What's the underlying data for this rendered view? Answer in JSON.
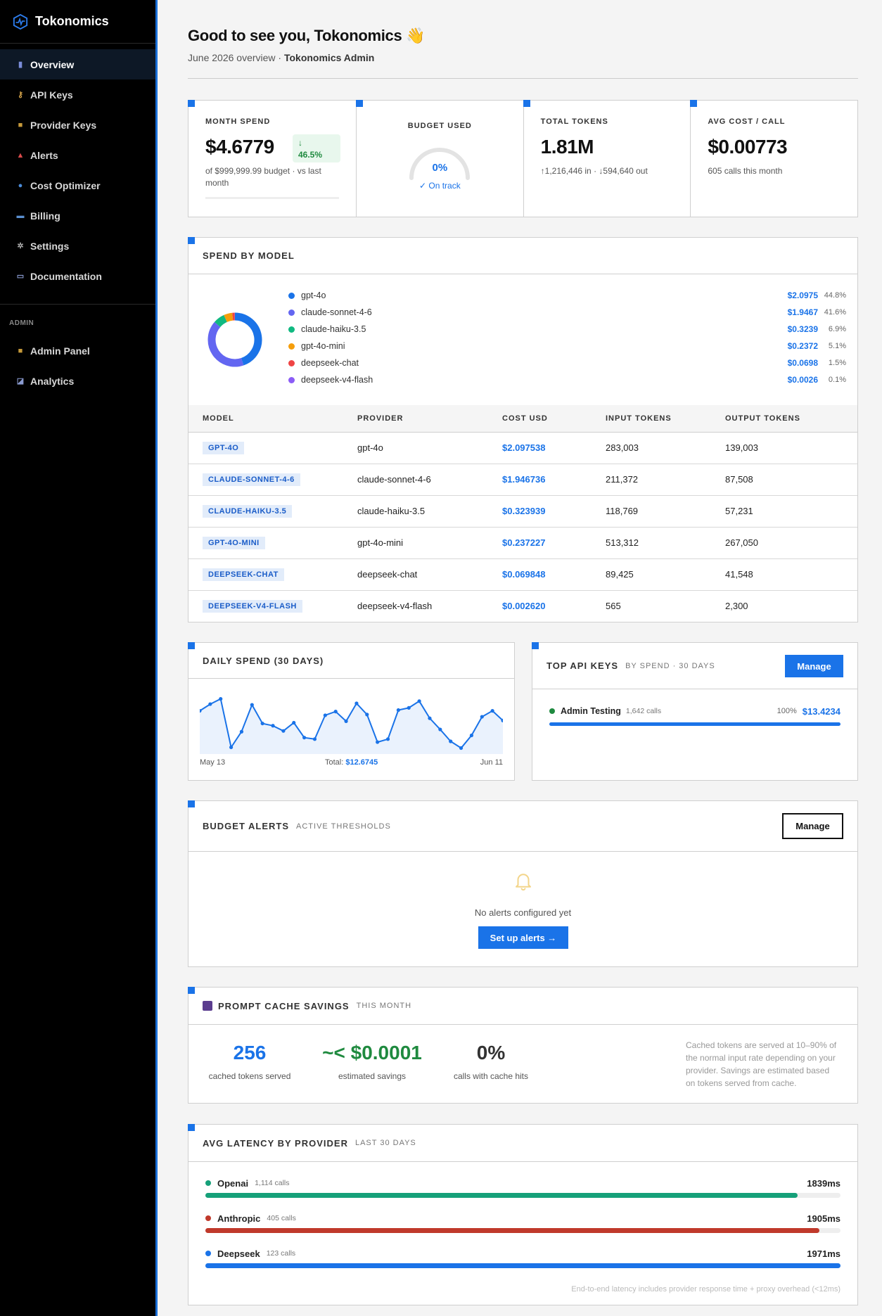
{
  "app": {
    "name": "Tokonomics"
  },
  "sidebar": {
    "items": [
      {
        "label": "Overview",
        "icon": "bar-chart-icon",
        "color": "#7a8cd8"
      },
      {
        "label": "API Keys",
        "icon": "key-icon",
        "color": "#d7a54a"
      },
      {
        "label": "Provider Keys",
        "icon": "lock-icon",
        "color": "#c79a3a"
      },
      {
        "label": "Alerts",
        "icon": "siren-icon",
        "color": "#d94b4b"
      },
      {
        "label": "Cost Optimizer",
        "icon": "magnifier-icon",
        "color": "#4a8bd8"
      },
      {
        "label": "Billing",
        "icon": "credit-card-icon",
        "color": "#5a8fd0"
      },
      {
        "label": "Settings",
        "icon": "gear-icon",
        "color": "#aaaaaa"
      },
      {
        "label": "Documentation",
        "icon": "book-icon",
        "color": "#8a9bd0"
      }
    ],
    "admin_section": "ADMIN",
    "admin_items": [
      {
        "label": "Admin Panel",
        "icon": "lock-icon",
        "color": "#c79a3a"
      },
      {
        "label": "Analytics",
        "icon": "line-chart-icon",
        "color": "#8a9bd0"
      }
    ]
  },
  "header": {
    "greeting": "Good to see you, Tokonomics 👋",
    "sub_prefix": "June 2026 overview · ",
    "sub_bold": "Tokonomics Admin"
  },
  "stats": {
    "month_spend": {
      "label": "MONTH SPEND",
      "value": "$4.6779",
      "change": "46.5%",
      "sub": "of $999,999.99 budget · vs last month"
    },
    "budget_used": {
      "label": "BUDGET USED",
      "value": "0%",
      "status": "✓ On track",
      "fraction": 0
    },
    "total_tokens": {
      "label": "TOTAL TOKENS",
      "value": "1.81M",
      "sub": "↑1,216,446 in · ↓594,640 out"
    },
    "avg_cost": {
      "label": "AVG COST / CALL",
      "value": "$0.00773",
      "sub": "605 calls this month"
    }
  },
  "spend_by_model": {
    "title": "SPEND BY MODEL",
    "legend": [
      {
        "name": "gpt-4o",
        "cost": "$2.0975",
        "pct": "44.8%",
        "share": 44.8,
        "color": "#1a73e8"
      },
      {
        "name": "claude-sonnet-4-6",
        "cost": "$1.9467",
        "pct": "41.6%",
        "share": 41.6,
        "color": "#6366f1"
      },
      {
        "name": "claude-haiku-3.5",
        "cost": "$0.3239",
        "pct": "6.9%",
        "share": 6.9,
        "color": "#10b981"
      },
      {
        "name": "gpt-4o-mini",
        "cost": "$0.2372",
        "pct": "5.1%",
        "share": 5.1,
        "color": "#f59e0b"
      },
      {
        "name": "deepseek-chat",
        "cost": "$0.0698",
        "pct": "1.5%",
        "share": 1.5,
        "color": "#ef4444"
      },
      {
        "name": "deepseek-v4-flash",
        "cost": "$0.0026",
        "pct": "0.1%",
        "share": 0.1,
        "color": "#8b5cf6"
      }
    ],
    "columns": [
      "MODEL",
      "PROVIDER",
      "COST USD",
      "INPUT TOKENS",
      "OUTPUT TOKENS"
    ],
    "rows": [
      {
        "model": "GPT-4O",
        "provider": "gpt-4o",
        "cost": "$2.097538",
        "input": "283,003",
        "output": "139,003"
      },
      {
        "model": "CLAUDE-SONNET-4-6",
        "provider": "claude-sonnet-4-6",
        "cost": "$1.946736",
        "input": "211,372",
        "output": "87,508"
      },
      {
        "model": "CLAUDE-HAIKU-3.5",
        "provider": "claude-haiku-3.5",
        "cost": "$0.323939",
        "input": "118,769",
        "output": "57,231"
      },
      {
        "model": "GPT-4O-MINI",
        "provider": "gpt-4o-mini",
        "cost": "$0.237227",
        "input": "513,312",
        "output": "267,050"
      },
      {
        "model": "DEEPSEEK-CHAT",
        "provider": "deepseek-chat",
        "cost": "$0.069848",
        "input": "89,425",
        "output": "41,548"
      },
      {
        "model": "DEEPSEEK-V4-FLASH",
        "provider": "deepseek-v4-flash",
        "cost": "$0.002620",
        "input": "565",
        "output": "2,300"
      }
    ]
  },
  "daily_spend": {
    "title": "DAILY SPEND (30 DAYS)",
    "start": "May 13",
    "end": "Jun 11",
    "total_label": "Total: ",
    "total_value": "$12.6745"
  },
  "chart_data": {
    "type": "area",
    "x_range": [
      "May 13",
      "Jun 11"
    ],
    "values": [
      0.58,
      0.67,
      0.74,
      0.09,
      0.3,
      0.66,
      0.41,
      0.38,
      0.31,
      0.42,
      0.22,
      0.2,
      0.52,
      0.57,
      0.44,
      0.68,
      0.53,
      0.16,
      0.2,
      0.59,
      0.62,
      0.71,
      0.48,
      0.33,
      0.17,
      0.08,
      0.25,
      0.5,
      0.58,
      0.45
    ],
    "ylim": [
      0,
      0.85
    ],
    "grid": false,
    "color": "#1a73e8"
  },
  "top_keys": {
    "title": "TOP API KEYS",
    "sub": "BY SPEND · 30 DAYS",
    "manage": "Manage",
    "items": [
      {
        "name": "Admin Testing",
        "calls": "1,642 calls",
        "pct": "100%",
        "cost": "$13.4234",
        "share": 1.0
      }
    ]
  },
  "budget_alerts": {
    "title": "BUDGET ALERTS",
    "sub": "ACTIVE THRESHOLDS",
    "manage": "Manage",
    "empty": "No alerts configured yet",
    "cta": "Set up alerts →"
  },
  "cache": {
    "title": "PROMPT CACHE SAVINGS",
    "sub": "THIS MONTH",
    "metrics": [
      {
        "value": "256",
        "label": "cached tokens served",
        "color": "#1a73e8"
      },
      {
        "value": "~< $0.0001",
        "label": "estimated savings",
        "color": "#1f8a3f"
      },
      {
        "value": "0%",
        "label": "calls with cache hits",
        "color": "#333333"
      }
    ],
    "note": "Cached tokens are served at 10–90% of the normal input rate depending on your provider. Savings are estimated based on tokens served from cache."
  },
  "latency": {
    "title": "AVG LATENCY BY PROVIDER",
    "sub": "LAST 30 DAYS",
    "items": [
      {
        "name": "Openai",
        "calls": "1,114 calls",
        "ms": "1839ms",
        "share": 0.933,
        "color": "#16a079"
      },
      {
        "name": "Anthropic",
        "calls": "405 calls",
        "ms": "1905ms",
        "share": 0.967,
        "color": "#c0392b"
      },
      {
        "name": "Deepseek",
        "calls": "123 calls",
        "ms": "1971ms",
        "share": 1.0,
        "color": "#1a73e8"
      }
    ],
    "footnote": "End-to-end latency includes provider response time + proxy overhead (<12ms)"
  }
}
